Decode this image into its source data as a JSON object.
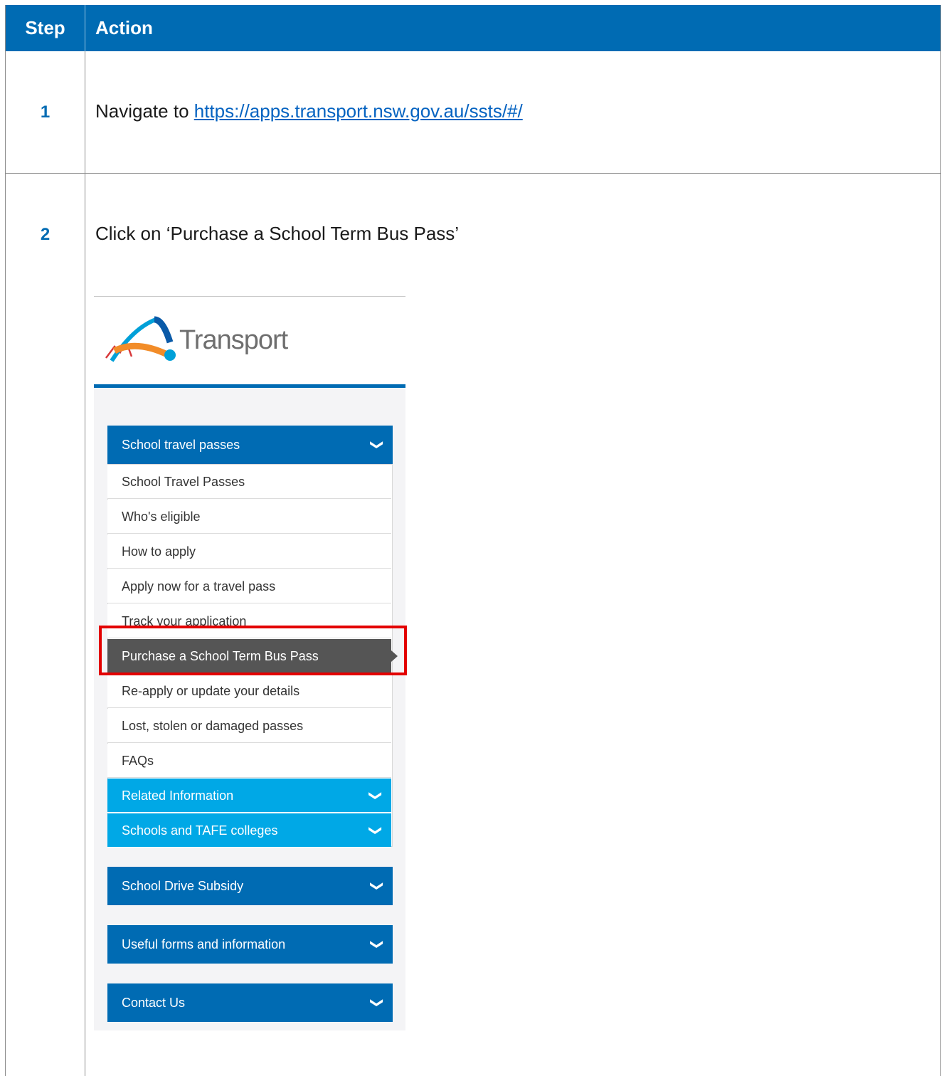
{
  "header": {
    "step": "Step",
    "action": "Action"
  },
  "rows": [
    {
      "step": "1",
      "text_prefix": "Navigate to ",
      "link": "https://apps.transport.nsw.gov.au/ssts/#/"
    },
    {
      "step": "2",
      "text": "Click on ‘Purchase a School Term Bus Pass’"
    }
  ],
  "screenshot": {
    "logo_text": "Transport",
    "sections": [
      {
        "label": "School travel passes"
      },
      {
        "label": "School Drive Subsidy"
      },
      {
        "label": "Useful forms and information"
      },
      {
        "label": "Contact Us"
      }
    ],
    "items": [
      "School Travel Passes",
      "Who's eligible",
      "How to apply",
      "Apply now for a travel pass",
      "Track your application",
      "Purchase a School Term Bus Pass",
      "Re-apply or update your details",
      "Lost, stolen or damaged passes",
      "FAQs"
    ],
    "subsections": [
      "Related Information",
      "Schools and TAFE colleges"
    ],
    "active_item": "Purchase a School Term Bus Pass"
  },
  "colors": {
    "header_blue": "#006bb3",
    "sub_blue": "#00a8e6",
    "active_grey": "#555555",
    "highlight_red": "#e30000"
  }
}
